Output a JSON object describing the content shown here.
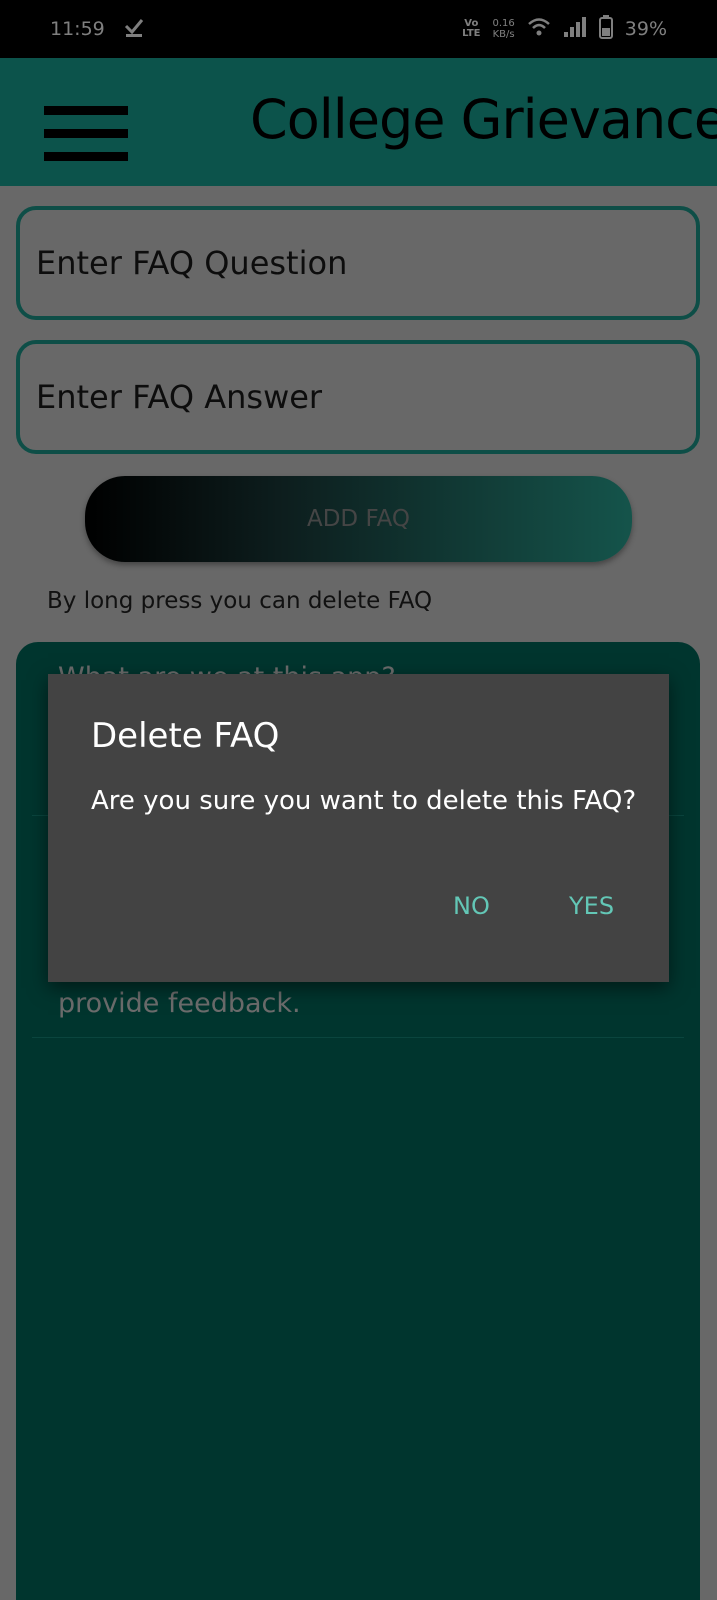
{
  "status_bar": {
    "time": "11:59",
    "volte": "Vo",
    "lte": "LTE",
    "speed_value": "0.16",
    "speed_unit": "KB/s",
    "battery": "39%"
  },
  "app_bar": {
    "title": "College Grievance"
  },
  "form": {
    "question_placeholder": "Enter FAQ Question",
    "answer_placeholder": "Enter FAQ Answer",
    "add_button": "ADD FAQ",
    "hint": "By long press you can delete FAQ"
  },
  "faq_list": {
    "items": [
      {
        "text": "What are we at this app?"
      },
      {
        "text": "provide feedback."
      }
    ]
  },
  "dialog": {
    "title": "Delete FAQ",
    "message": "Are you sure you want to delete this FAQ?",
    "no_label": "NO",
    "yes_label": "YES"
  },
  "colors": {
    "app_bar": "#19a797",
    "list_bg": "#016a5d",
    "dialog_bg": "#434343",
    "dialog_button": "#63c7b6"
  }
}
